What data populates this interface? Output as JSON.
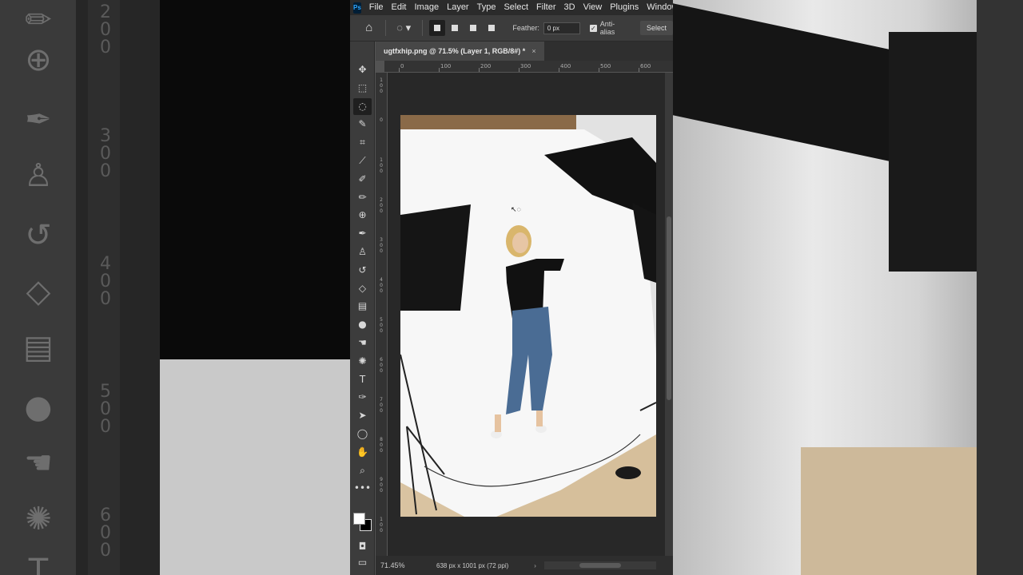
{
  "app": {
    "logo": "Ps"
  },
  "menubar": {
    "items": [
      "File",
      "Edit",
      "Image",
      "Layer",
      "Type",
      "Select",
      "Filter",
      "3D",
      "View",
      "Plugins",
      "Window"
    ]
  },
  "options": {
    "feather_label": "Feather:",
    "feather_value": "0 px",
    "antialias_label": "Anti-alias",
    "antialias_checked": true,
    "select_button": "Select"
  },
  "document": {
    "tab_title": "ugtfxhip.png @ 71.5% (Layer 1, RGB/8#) *",
    "close": "×"
  },
  "ruler": {
    "h_ticks": [
      "0",
      "100",
      "200",
      "300",
      "400",
      "500",
      "600"
    ],
    "v_ticks": [
      "1\n0\n0",
      "0",
      "1\n0\n0",
      "2\n0\n0",
      "3\n0\n0",
      "4\n0\n0",
      "5\n0\n0",
      "6\n0\n0",
      "7\n0\n0",
      "8\n0\n0",
      "9\n0\n0",
      "1\n0\n0"
    ]
  },
  "status": {
    "zoom": "71.45%",
    "doc_info": "638 px x 1001 px (72 ppi)",
    "arrow": "›"
  },
  "tools": [
    {
      "name": "move-tool-icon",
      "glyph": "✥"
    },
    {
      "name": "marquee-tool-icon",
      "glyph": "⬚"
    },
    {
      "name": "lasso-tool-icon",
      "glyph": "◌"
    },
    {
      "name": "quick-select-tool-icon",
      "glyph": "✎"
    },
    {
      "name": "crop-tool-icon",
      "glyph": "⌗"
    },
    {
      "name": "eyedropper-tool-icon",
      "glyph": "⟋"
    },
    {
      "name": "brush-tool-icon",
      "glyph": "✐"
    },
    {
      "name": "pencil-tool-icon",
      "glyph": "✏"
    },
    {
      "name": "healing-brush-tool-icon",
      "glyph": "⊕"
    },
    {
      "name": "brush-alt-tool-icon",
      "glyph": "✒"
    },
    {
      "name": "clone-stamp-tool-icon",
      "glyph": "♙"
    },
    {
      "name": "history-brush-tool-icon",
      "glyph": "↺"
    },
    {
      "name": "eraser-tool-icon",
      "glyph": "◇"
    },
    {
      "name": "gradient-tool-icon",
      "glyph": "▤"
    },
    {
      "name": "blur-tool-icon",
      "glyph": "●"
    },
    {
      "name": "smudge-tool-icon",
      "glyph": "☚"
    },
    {
      "name": "sponge-tool-icon",
      "glyph": "✺"
    },
    {
      "name": "type-tool-icon",
      "glyph": "T"
    },
    {
      "name": "pen-tool-icon",
      "glyph": "✑"
    },
    {
      "name": "path-select-tool-icon",
      "glyph": "➤"
    },
    {
      "name": "ellipse-tool-icon",
      "glyph": "◯"
    },
    {
      "name": "hand-tool-icon",
      "glyph": "✋"
    },
    {
      "name": "zoom-tool-icon",
      "glyph": "⌕"
    },
    {
      "name": "more-tools-icon",
      "glyph": "•••"
    },
    {
      "name": "quick-mask-icon",
      "glyph": "◘"
    },
    {
      "name": "screen-mode-icon",
      "glyph": "▭"
    }
  ],
  "colors": {
    "foreground": "#ffffff",
    "background": "#000000"
  }
}
